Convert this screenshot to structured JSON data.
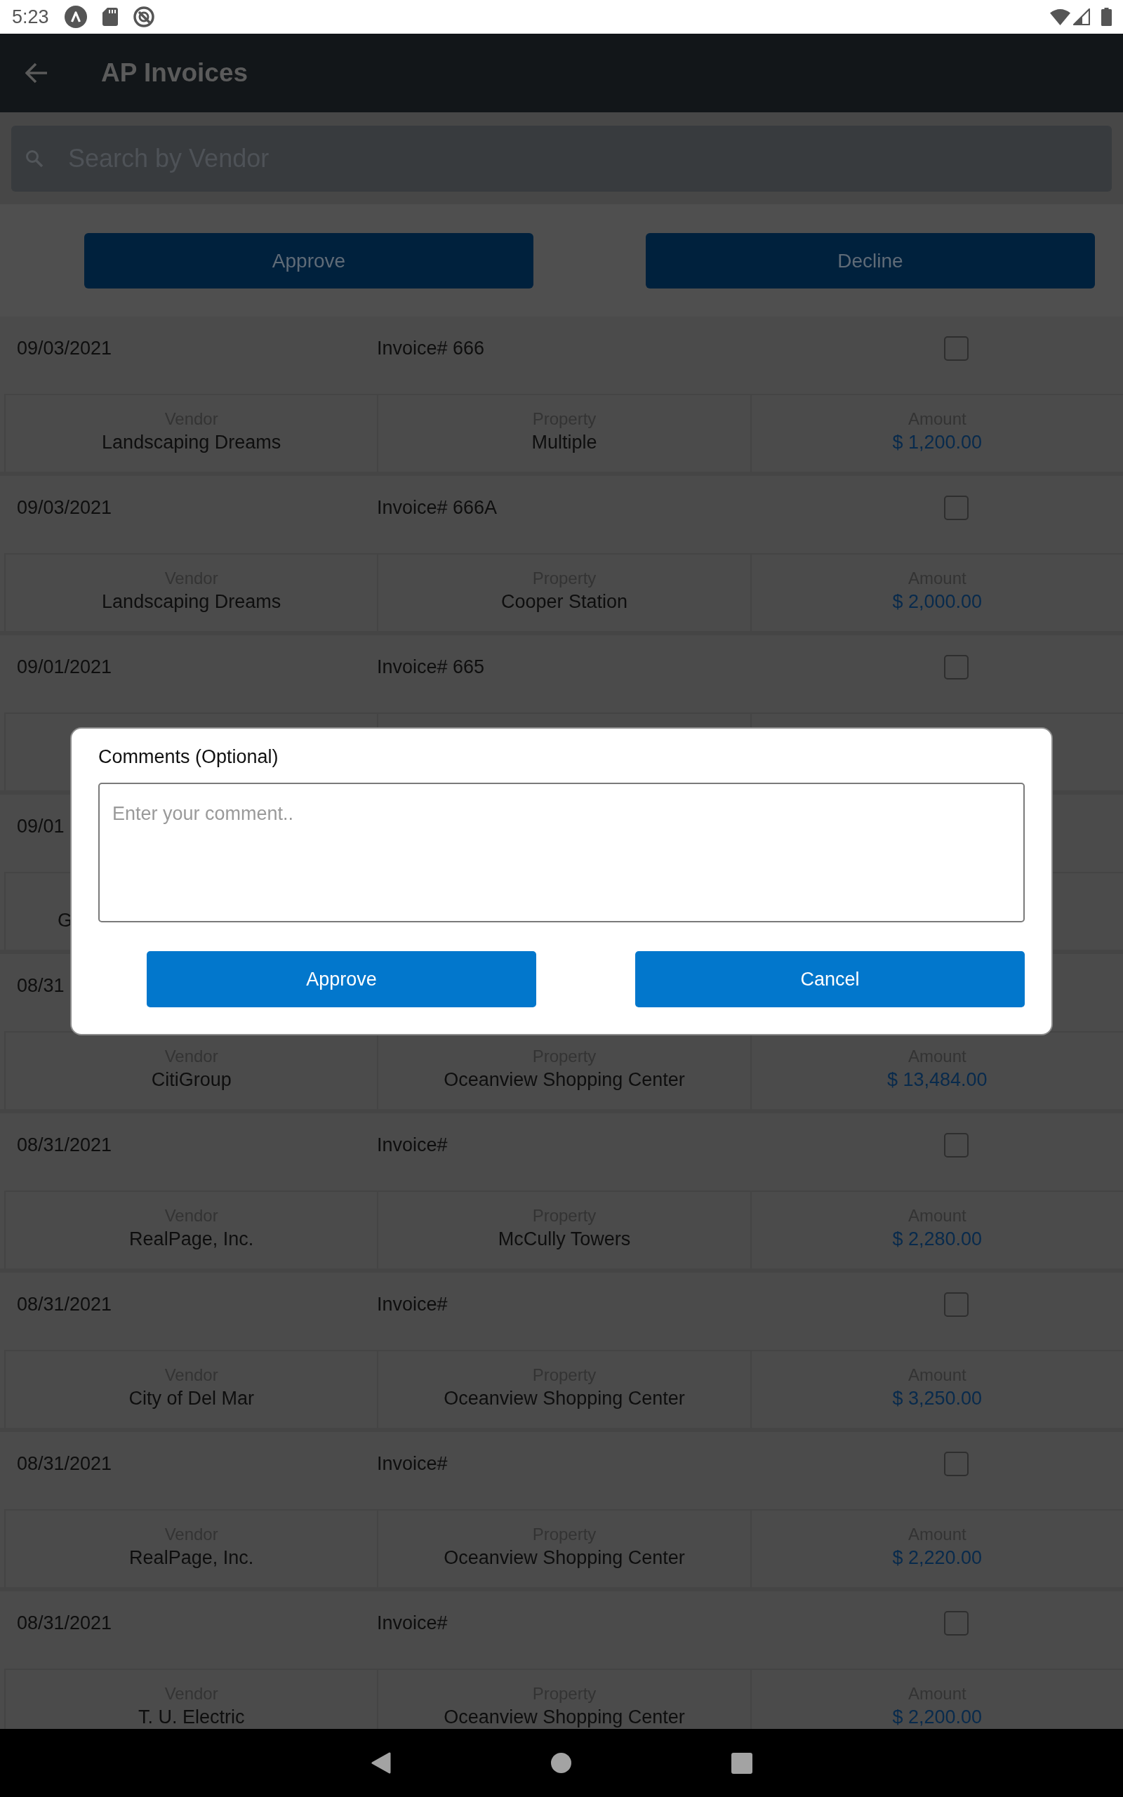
{
  "status_bar": {
    "time": "5:23"
  },
  "app_bar": {
    "title": "AP Invoices"
  },
  "search": {
    "placeholder": "Search by Vendor"
  },
  "actions": [
    "Approve",
    "Decline"
  ],
  "invoices": [
    {
      "kind": "full",
      "date": "09/03/2021",
      "invoice": "Invoice# 666",
      "checked": false,
      "fields": [
        {
          "kind": "text",
          "label": "Vendor",
          "value": "Landscaping Dreams"
        },
        {
          "kind": "text",
          "label": "Property",
          "value": "Multiple"
        },
        {
          "kind": "amount",
          "label": "Amount",
          "value": "$ 1,200.00"
        }
      ]
    },
    {
      "kind": "full",
      "date": "09/03/2021",
      "invoice": "Invoice# 666A",
      "checked": false,
      "fields": [
        {
          "kind": "text",
          "label": "Vendor",
          "value": "Landscaping Dreams"
        },
        {
          "kind": "text",
          "label": "Property",
          "value": "Cooper Station"
        },
        {
          "kind": "amount",
          "label": "Amount",
          "value": "$ 2,000.00"
        }
      ]
    },
    {
      "kind": "full",
      "date": "09/01/2021",
      "invoice": "Invoice# 665",
      "checked": false
    },
    {
      "kind": "partial",
      "date": "09/01",
      "fields": [
        {
          "kind": "text",
          "value": "G"
        }
      ]
    },
    {
      "kind": "full",
      "date": "08/31",
      "fields": [
        {
          "kind": "text",
          "label": "Vendor",
          "value": "CitiGroup"
        },
        {
          "kind": "text",
          "label": "Property",
          "value": "Oceanview Shopping Center"
        },
        {
          "kind": "amount",
          "label": "Amount",
          "value": "$ 13,484.00"
        }
      ]
    },
    {
      "kind": "full",
      "date": "08/31/2021",
      "invoice": "Invoice#",
      "checked": false,
      "fields": [
        {
          "kind": "text",
          "label": "Vendor",
          "value": "RealPage, Inc."
        },
        {
          "kind": "text",
          "label": "Property",
          "value": "McCully Towers"
        },
        {
          "kind": "amount",
          "label": "Amount",
          "value": "$ 2,280.00"
        }
      ]
    },
    {
      "kind": "full",
      "date": "08/31/2021",
      "invoice": "Invoice#",
      "checked": false,
      "fields": [
        {
          "kind": "text",
          "label": "Vendor",
          "value": "City of Del Mar"
        },
        {
          "kind": "text",
          "label": "Property",
          "value": "Oceanview Shopping Center"
        },
        {
          "kind": "amount",
          "label": "Amount",
          "value": "$ 3,250.00"
        }
      ]
    },
    {
      "kind": "full",
      "date": "08/31/2021",
      "invoice": "Invoice#",
      "checked": false,
      "fields": [
        {
          "kind": "text",
          "label": "Vendor",
          "value": "RealPage, Inc."
        },
        {
          "kind": "text",
          "label": "Property",
          "value": "Oceanview Shopping Center"
        },
        {
          "kind": "amount",
          "label": "Amount",
          "value": "$ 2,220.00"
        }
      ]
    },
    {
      "kind": "full",
      "date": "08/31/2021",
      "invoice": "Invoice#",
      "checked": false,
      "fields": [
        {
          "kind": "text",
          "label": "Vendor",
          "value": "T. U. Electric"
        },
        {
          "kind": "text",
          "label": "Property",
          "value": "Oceanview Shopping Center"
        },
        {
          "kind": "amount",
          "label": "Amount",
          "value": "$ 2,200.00"
        }
      ]
    }
  ],
  "dialog": {
    "title": "Comments (Optional)",
    "comment": {
      "placeholder": "Enter your comment.."
    },
    "buttons": [
      "Approve",
      "Cancel"
    ]
  }
}
